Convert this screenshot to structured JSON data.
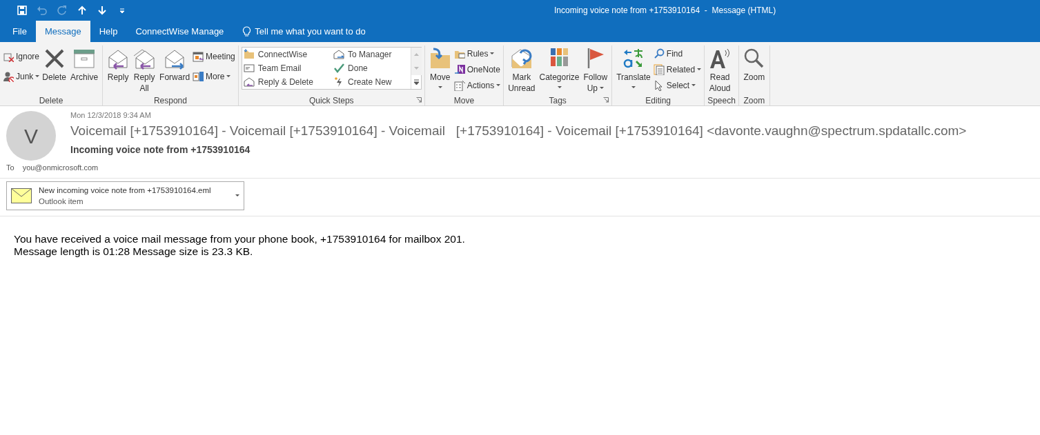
{
  "window": {
    "title": "Incoming voice note from +1753910164  -  Message (HTML)"
  },
  "quick_access": [
    {
      "disabled": false
    },
    {
      "disabled": true
    },
    {
      "disabled": true
    },
    {
      "disabled": false
    },
    {
      "disabled": false
    },
    {
      "disabled": false
    }
  ],
  "tabs": [
    {
      "label": "File",
      "selected": false
    },
    {
      "label": "Message",
      "selected": true
    },
    {
      "label": "Help",
      "selected": false
    },
    {
      "label": "ConnectWise Manage",
      "selected": false
    }
  ],
  "tell_me": "Tell me what you want to do",
  "ribbon": {
    "groups": [
      {
        "label": "Delete",
        "dialog_launcher": false,
        "columns": [
          {
            "kind": "small",
            "buttons": [
              {
                "lines": [
                  "Ignore"
                ],
                "dropdown": false
              },
              {
                "lines": [
                  "Junk"
                ],
                "dropdown": true
              }
            ]
          },
          {
            "kind": "large",
            "buttons": [
              {
                "lines": [
                  "Delete"
                ],
                "dropdown": false
              }
            ]
          },
          {
            "kind": "large",
            "buttons": [
              {
                "lines": [
                  "Archive"
                ],
                "dropdown": false
              }
            ]
          }
        ]
      },
      {
        "label": "Respond",
        "dialog_launcher": false,
        "columns": [
          {
            "kind": "large",
            "buttons": [
              {
                "lines": [
                  "Reply"
                ],
                "dropdown": false
              }
            ]
          },
          {
            "kind": "large",
            "buttons": [
              {
                "lines": [
                  "Reply",
                  "All"
                ],
                "dropdown": false
              }
            ]
          },
          {
            "kind": "large",
            "buttons": [
              {
                "lines": [
                  "Forward"
                ],
                "dropdown": false
              }
            ]
          },
          {
            "kind": "small",
            "buttons": [
              {
                "lines": [
                  "Meeting"
                ],
                "dropdown": false
              },
              {
                "lines": [
                  "More"
                ],
                "dropdown": true
              }
            ]
          }
        ]
      },
      {
        "label": "Quick Steps",
        "dialog_launcher": true,
        "columns": [
          {
            "kind": "gallery",
            "buttons": [
              {
                "lines": [
                  "ConnectWise"
                ]
              },
              {
                "lines": [
                  "Team Email"
                ]
              },
              {
                "lines": [
                  "Reply & Delete"
                ]
              },
              {
                "lines": [
                  "To Manager"
                ]
              },
              {
                "lines": [
                  "Done"
                ]
              },
              {
                "lines": [
                  "Create New"
                ]
              }
            ]
          }
        ]
      },
      {
        "label": "Move",
        "dialog_launcher": false,
        "columns": [
          {
            "kind": "large",
            "buttons": [
              {
                "lines": [
                  "Move"
                ],
                "dropdown": true
              }
            ]
          },
          {
            "kind": "small",
            "buttons": [
              {
                "lines": [
                  "Rules"
                ],
                "dropdown": true
              },
              {
                "lines": [
                  "OneNote"
                ],
                "dropdown": false
              },
              {
                "lines": [
                  "Actions"
                ],
                "dropdown": true
              }
            ]
          }
        ]
      },
      {
        "label": "Tags",
        "dialog_launcher": true,
        "columns": [
          {
            "kind": "large",
            "buttons": [
              {
                "lines": [
                  "Mark",
                  "Unread"
                ],
                "dropdown": false
              }
            ]
          },
          {
            "kind": "large",
            "buttons": [
              {
                "lines": [
                  "Categorize"
                ],
                "dropdown": true
              }
            ]
          },
          {
            "kind": "large",
            "buttons": [
              {
                "lines": [
                  "Follow",
                  "Up"
                ],
                "dropdown": true
              }
            ]
          }
        ]
      },
      {
        "label": "Editing",
        "dialog_launcher": false,
        "columns": [
          {
            "kind": "large",
            "buttons": [
              {
                "lines": [
                  "Translate"
                ],
                "dropdown": true
              }
            ]
          },
          {
            "kind": "small",
            "buttons": [
              {
                "lines": [
                  "Find"
                ],
                "dropdown": false
              },
              {
                "lines": [
                  "Related"
                ],
                "dropdown": true
              },
              {
                "lines": [
                  "Select"
                ],
                "dropdown": true
              }
            ]
          }
        ]
      },
      {
        "label": "Speech",
        "dialog_launcher": false,
        "columns": [
          {
            "kind": "large",
            "buttons": [
              {
                "lines": [
                  "Read",
                  "Aloud"
                ],
                "dropdown": false
              }
            ]
          }
        ]
      },
      {
        "label": "Zoom",
        "dialog_launcher": false,
        "columns": [
          {
            "kind": "large",
            "buttons": [
              {
                "lines": [
                  "Zoom"
                ],
                "dropdown": false
              }
            ]
          }
        ]
      }
    ]
  },
  "message": {
    "avatar_initial": "V",
    "date": "Mon 12/3/2018 9:34 AM",
    "sender": "Voicemail [+1753910164] - Voicemail [+1753910164] - Voicemail   [+1753910164] - Voicemail [+1753910164] <davonte.vaughn@spectrum.spdatallc.com>",
    "subject": "Incoming voice note from +1753910164",
    "to_label": "To",
    "to": "you@onmicrosoft.com",
    "attachment": {
      "name": "New incoming voice note from +1753910164.eml",
      "type": "Outlook item"
    },
    "body": [
      "You have received a voice mail message from your phone book, +1753910164 for mailbox 201.",
      "Message length is 01:28 Message size is 23.3 KB."
    ]
  }
}
